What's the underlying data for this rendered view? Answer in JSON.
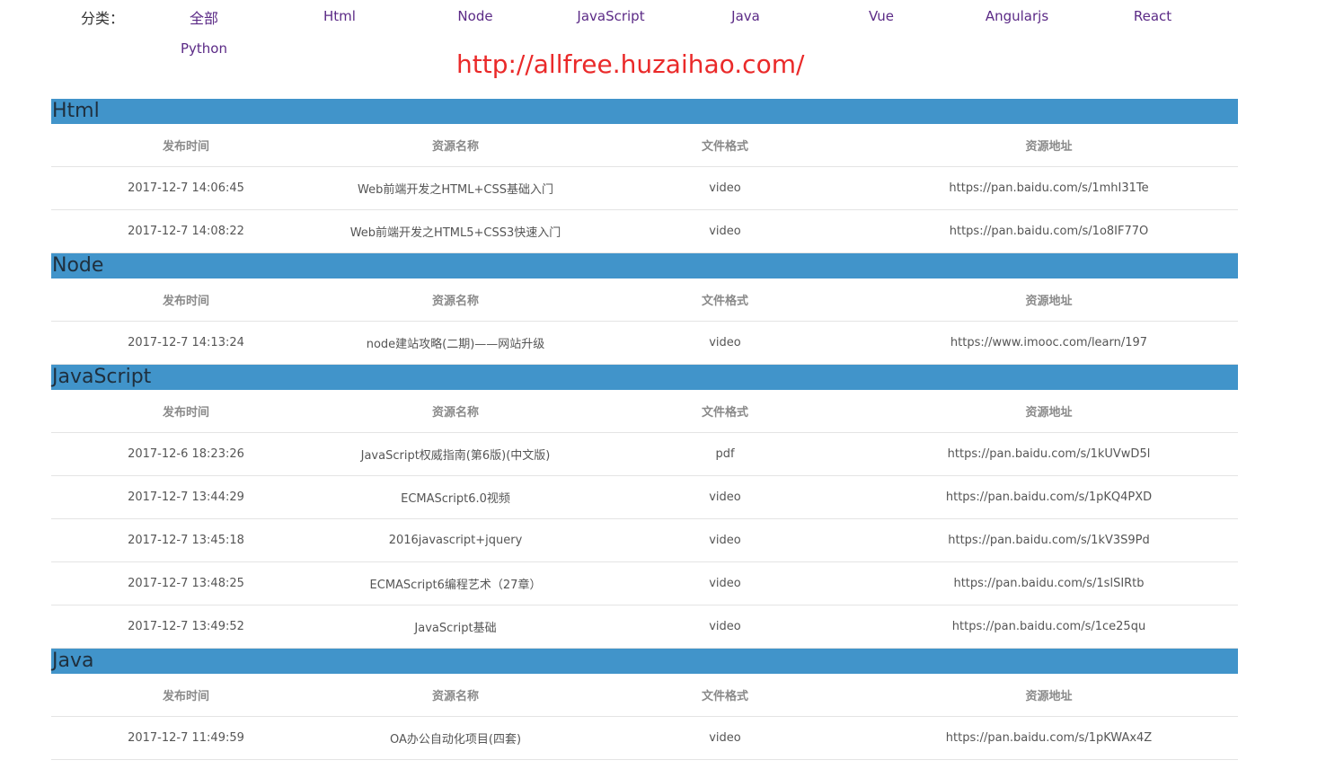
{
  "nav": {
    "label": "分类：",
    "items": [
      {
        "label": "全部"
      },
      {
        "label": "Html"
      },
      {
        "label": "Node"
      },
      {
        "label": "JavaScript"
      },
      {
        "label": "Java"
      },
      {
        "label": "Vue"
      },
      {
        "label": "Angularjs"
      },
      {
        "label": "React"
      },
      {
        "label": "Python"
      }
    ]
  },
  "site_url": "http://allfree.huzaihao.com/",
  "colors": {
    "accent": "#4194ca",
    "link": "#5b2a86",
    "url": "#ea2a2a"
  },
  "columns": [
    "发布时间",
    "资源名称",
    "文件格式",
    "资源地址"
  ],
  "sections": [
    {
      "title": "Html",
      "rows": [
        [
          "2017-12-7 14:06:45",
          "Web前端开发之HTML+CSS基础入门",
          "video",
          "https://pan.baidu.com/s/1mhI31Te"
        ],
        [
          "2017-12-7 14:08:22",
          "Web前端开发之HTML5+CSS3快速入门",
          "video",
          "https://pan.baidu.com/s/1o8IF77O"
        ]
      ]
    },
    {
      "title": "Node",
      "rows": [
        [
          "2017-12-7 14:13:24",
          "node建站攻略(二期)——网站升级",
          "video",
          "https://www.imooc.com/learn/197"
        ]
      ]
    },
    {
      "title": "JavaScript",
      "rows": [
        [
          "2017-12-6 18:23:26",
          "JavaScript权威指南(第6版)(中文版)",
          "pdf",
          "https://pan.baidu.com/s/1kUVwD5l"
        ],
        [
          "2017-12-7 13:44:29",
          "ECMAScript6.0视频",
          "video",
          "https://pan.baidu.com/s/1pKQ4PXD"
        ],
        [
          "2017-12-7 13:45:18",
          "2016javascript+jquery",
          "video",
          "https://pan.baidu.com/s/1kV3S9Pd"
        ],
        [
          "2017-12-7 13:48:25",
          "ECMAScript6编程艺术（27章）",
          "video",
          "https://pan.baidu.com/s/1slSIRtb"
        ],
        [
          "2017-12-7 13:49:52",
          "JavaScript基础",
          "video",
          "https://pan.baidu.com/s/1ce25qu"
        ]
      ]
    },
    {
      "title": "Java",
      "rows": [
        [
          "2017-12-7 11:49:59",
          "OA办公自动化项目(四套)",
          "video",
          "https://pan.baidu.com/s/1pKWAx4Z"
        ]
      ]
    }
  ]
}
